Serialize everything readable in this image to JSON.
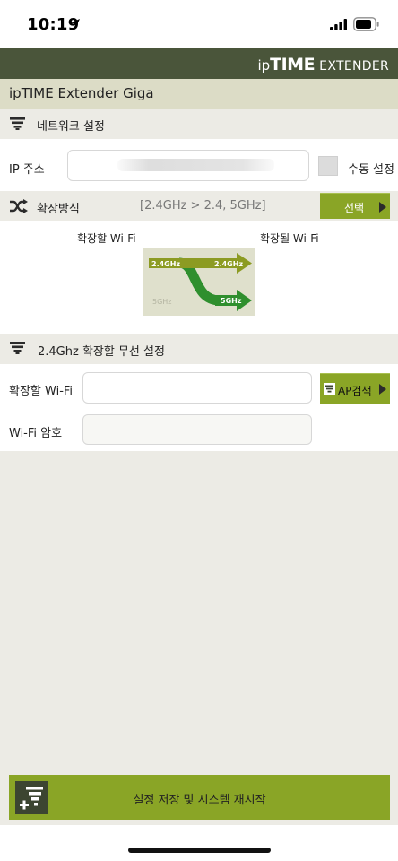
{
  "status_bar": {
    "time": "10:19"
  },
  "header": {
    "brand_ip": "ip",
    "brand_time": "TIME",
    "brand_extender": "EXTENDER",
    "device_title": "ipTIME Extender Giga"
  },
  "network": {
    "section_title": "네트워크 설정",
    "ip_label": "IP 주소",
    "ip_value": "",
    "manual_label": "수동 설정"
  },
  "extension": {
    "section_title": "확장방식",
    "mode_value": "[2.4GHz > 2.4, 5GHz]",
    "select_button": "선택",
    "source_caption": "확장할 Wi-Fi",
    "target_caption": "확장될 Wi-Fi",
    "diagram": {
      "source_band": "2.4GHz",
      "target_band_1": "2.4GHz",
      "target_band_2": "5GHz",
      "inactive_band": "5GHz"
    }
  },
  "wireless": {
    "section_title": "2.4Ghz 확장할 무선 설정",
    "wifi_label": "확장할 Wi-Fi",
    "wifi_value": "",
    "ap_search_button": "AP검색",
    "password_label": "Wi-Fi 암호",
    "password_value": ""
  },
  "footer": {
    "save_restart_label": "설정 저장 및 시스템 재시작"
  },
  "colors": {
    "header_bg": "#4a553a",
    "device_bar_bg": "#dcdcc6",
    "accent_green": "#8aa526",
    "page_bg": "#ecebe5"
  }
}
